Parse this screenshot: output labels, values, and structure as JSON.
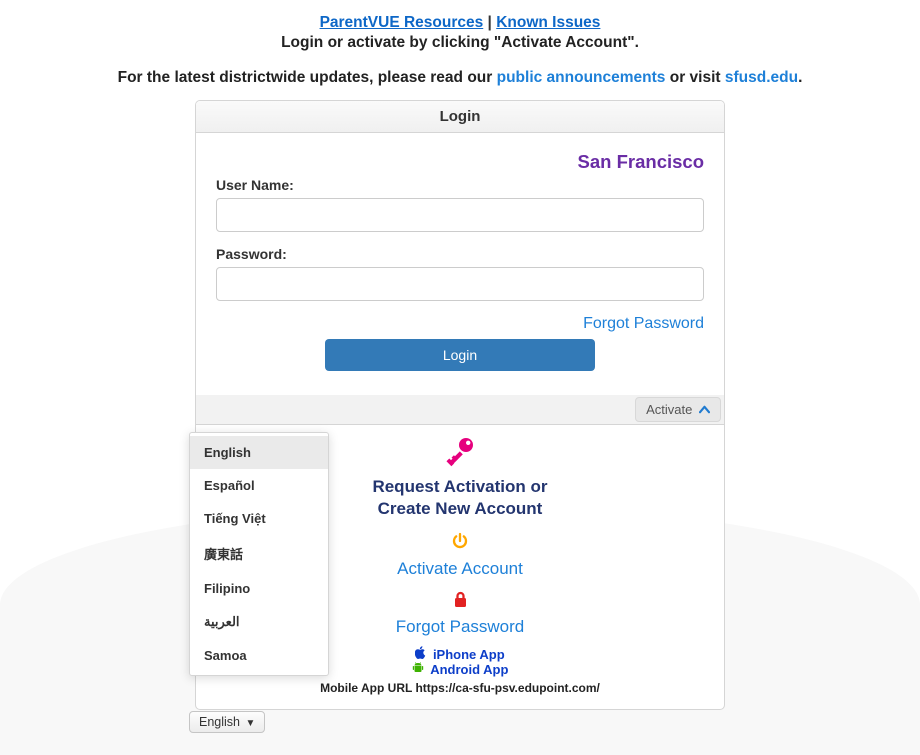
{
  "header": {
    "parentvue_resources": "ParentVUE Resources",
    "sep": " | ",
    "known_issues": "Known Issues",
    "activate_line": "Login or activate by clicking \"Activate Account\".",
    "updates_prefix": "For the latest districtwide updates, please read our ",
    "public_announcements": "public announcements",
    "updates_mid": " or visit ",
    "sfusd": "sfusd.edu",
    "updates_suffix": "."
  },
  "login": {
    "panel_title": "Login",
    "district": "San Francisco",
    "username_label": "User Name:",
    "password_label": "Password:",
    "forgot": "Forgot Password",
    "login_btn": "Login",
    "activate_toggle": "Activate"
  },
  "activation": {
    "request_line1": "Request Activation or",
    "request_line2": "Create New Account",
    "activate_account": "Activate Account",
    "forgot_password": "Forgot Password",
    "iphone_app": "iPhone App",
    "android_app": "Android App",
    "mobile_url_label": "Mobile App URL ",
    "mobile_url": "https://ca-sfu-psv.edupoint.com/"
  },
  "languages": {
    "current": "English",
    "items": [
      "English",
      "Español",
      "Tiếng Việt",
      "廣東話",
      "Filipino",
      "العربية",
      "Samoa"
    ]
  }
}
